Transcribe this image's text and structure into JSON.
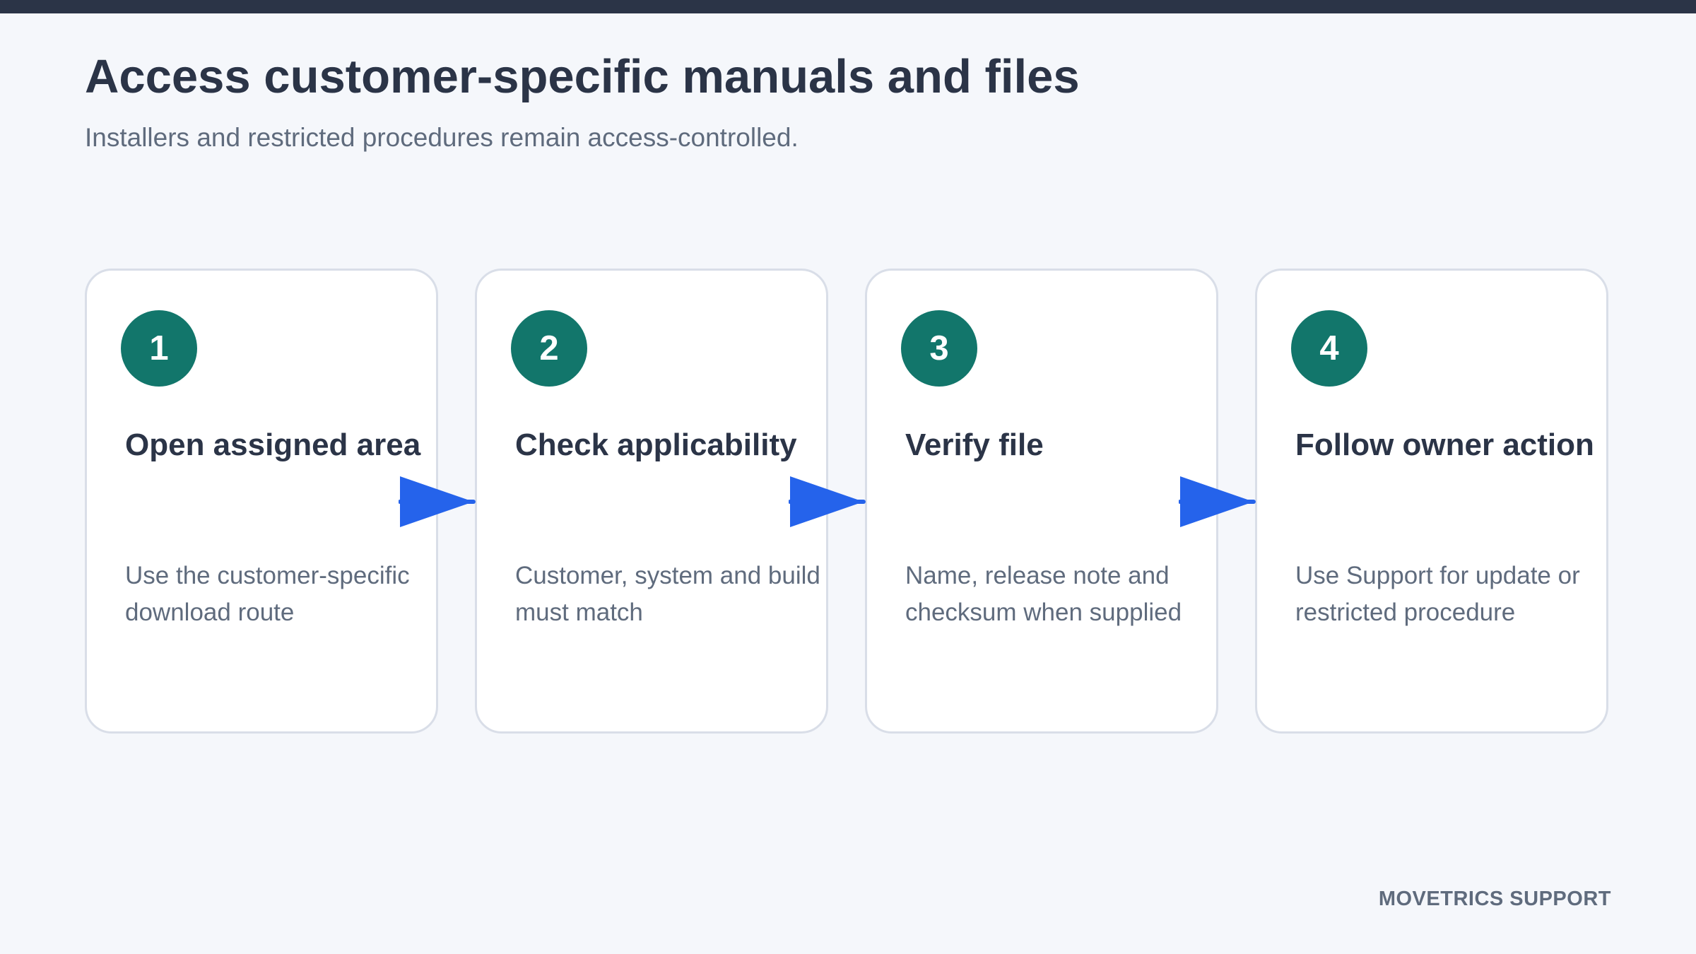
{
  "header": {
    "title": "Access customer-specific manuals and files",
    "subtitle": "Installers and restricted procedures remain access-controlled."
  },
  "steps": [
    {
      "number": "1",
      "title": "Open assigned area",
      "description": "Use the customer-specific download route"
    },
    {
      "number": "2",
      "title": "Check applicability",
      "description": "Customer, system and build must match"
    },
    {
      "number": "3",
      "title": "Verify file",
      "description": "Name, release note and checksum when supplied"
    },
    {
      "number": "4",
      "title": "Follow owner action",
      "description": "Use Support for update or restricted procedure"
    }
  ],
  "footer": {
    "brand": "MOVETRICS SUPPORT"
  },
  "colors": {
    "top_bar": "#2b3447",
    "badge": "#12766b",
    "arrow": "#2563eb",
    "background": "#f5f7fb"
  },
  "icons": {
    "connector": "arrow-right-icon"
  }
}
